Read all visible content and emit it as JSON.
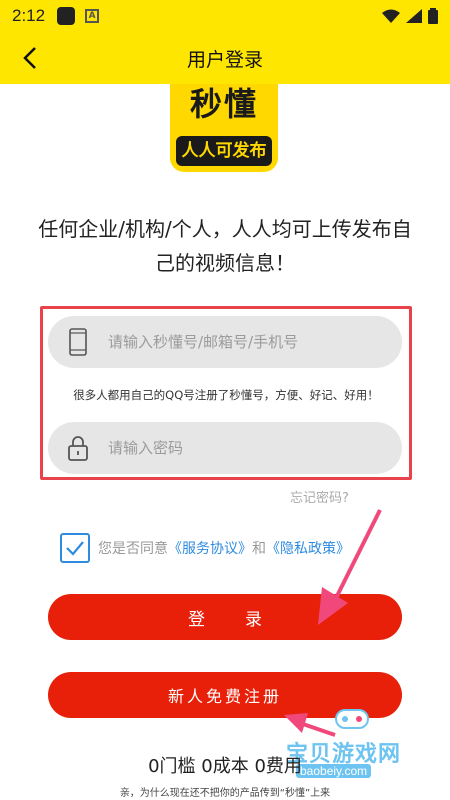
{
  "status_bar": {
    "time": "2:12"
  },
  "header": {
    "title": "用户登录"
  },
  "logo": {
    "main": "秒懂",
    "sub": "人人可发布"
  },
  "slogan": {
    "line1": "任何企业/机构/个人，人人均可上传发布自",
    "line2": "己的视频信息！"
  },
  "form": {
    "account_placeholder": "请输入秒懂号/邮箱号/手机号",
    "tip": "很多人都用自己的QQ号注册了秒懂号，方便、好记、好用！",
    "password_placeholder": "请输入密码",
    "forgot": "忘记密码?"
  },
  "agreement": {
    "prefix": "您是否同意",
    "service_link": "《服务协议》",
    "and": "和",
    "privacy_link": "《隐私政策》"
  },
  "buttons": {
    "login": "登录",
    "register": "新人免费注册"
  },
  "bottom": {
    "slogan": "0门槛 0成本 0费用",
    "text": "亲，为什么现在还不把你的产品传到“秒懂”上来"
  },
  "watermark": {
    "text": "宝贝游戏网",
    "url": "baobeiy.com"
  },
  "colors": {
    "accent_yellow": "#ffe600",
    "primary_red": "#e8200a",
    "link_blue": "#2f8bdf",
    "highlight_red": "#e8434a"
  }
}
